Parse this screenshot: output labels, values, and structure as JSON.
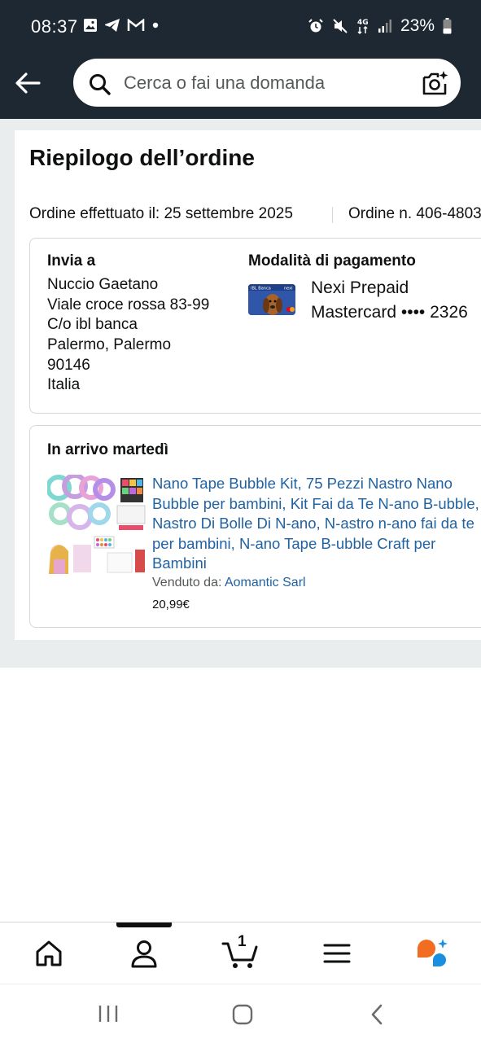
{
  "status_bar": {
    "time": "08:37",
    "battery": "23%",
    "icons": [
      "gallery-icon",
      "telegram-icon",
      "gmail-icon",
      "dot-icon",
      "alarm-icon",
      "mute-icon",
      "4g-icon",
      "signal-icon",
      "battery-icon"
    ]
  },
  "header": {
    "search_placeholder": "Cerca o fai una domanda"
  },
  "order": {
    "title": "Riepilogo dell’ordine",
    "placed_label": "Ordine effettuato il: 25 settembre 2025",
    "order_number": "Ordine n. 406-4803"
  },
  "shipping": {
    "title": "Invia a",
    "lines": [
      "Nuccio Gaetano",
      "Viale croce rossa 83-99",
      "C/o ibl banca",
      "Palermo, Palermo",
      "90146",
      "Italia"
    ]
  },
  "payment": {
    "title": "Modalità di pagamento",
    "line1": "Nexi Prepaid",
    "line2": "Mastercard •••• 2326",
    "card_bank": "IBL Banca",
    "card_brand": "nexi"
  },
  "delivery": {
    "title": "In arrivo martedì",
    "product_title": "Nano Tape Bubble Kit, 75 Pezzi Nastro Nano Bubble per bambini, Kit Fai da Te N-ano B-ubble, Nastro Di Bolle Di N-ano, N-astro n-ano fai da te per bambini, N-ano Tape B-ubble Craft per Bambini",
    "sold_by_label": "Venduto da:",
    "seller": "Aomantic Sarl",
    "price": "20,99€"
  },
  "bottom_nav": {
    "items": [
      "home-icon",
      "account-icon",
      "cart-icon",
      "menu-icon",
      "rufus-icon"
    ],
    "cart_count": "1"
  },
  "colors": {
    "header_bg": "#1d2832",
    "link": "#2162a1",
    "page_bg": "#eaeded"
  }
}
